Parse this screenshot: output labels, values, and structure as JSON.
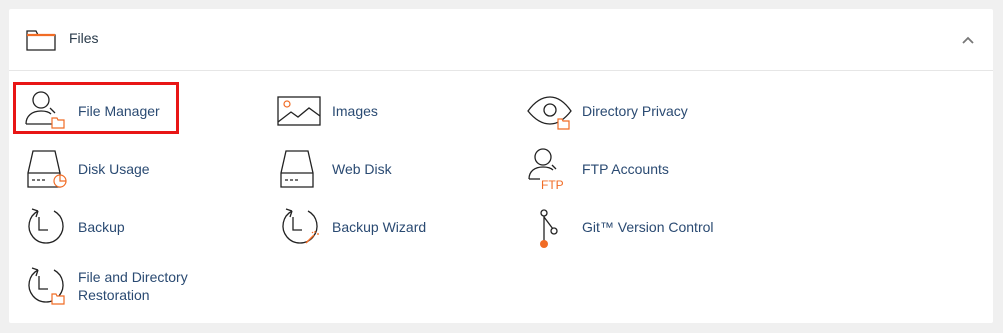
{
  "section": {
    "title": "Files",
    "collapse_icon": "chevron-up-icon"
  },
  "colors": {
    "accent": "#f16c25",
    "link": "#2a4a72",
    "highlight": "#e81515"
  },
  "items": [
    {
      "label": "File Manager",
      "icon": "file-manager-icon"
    },
    {
      "label": "Images",
      "icon": "images-icon"
    },
    {
      "label": "Directory Privacy",
      "icon": "directory-privacy-icon"
    },
    {
      "label": "Disk Usage",
      "icon": "disk-usage-icon"
    },
    {
      "label": "Web Disk",
      "icon": "web-disk-icon"
    },
    {
      "label": "FTP Accounts",
      "icon": "ftp-accounts-icon"
    },
    {
      "label": "Backup",
      "icon": "backup-icon"
    },
    {
      "label": "Backup Wizard",
      "icon": "backup-wizard-icon"
    },
    {
      "label": "Git™ Version Control",
      "icon": "git-version-control-icon"
    },
    {
      "label": "File and Directory Restoration",
      "icon": "file-restoration-icon"
    }
  ],
  "ftp_icon_text": "FTP"
}
